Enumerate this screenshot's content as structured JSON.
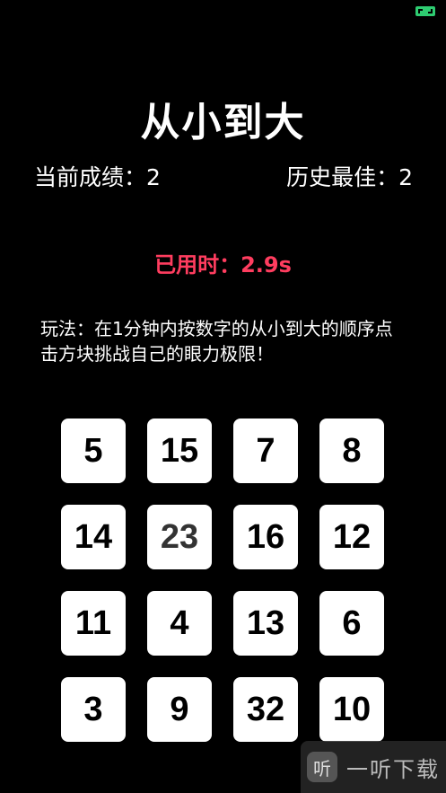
{
  "title": "从小到大",
  "score": {
    "current_label": "当前成绩：2",
    "best_label": "历史最佳：2"
  },
  "timer": "已用时：2.9s",
  "rules": "玩法：在1分钟内按数字的从小到大的顺序点击方块挑战自己的眼力极限！",
  "tiles": [
    "5",
    "15",
    "7",
    "8",
    "14",
    "23",
    "16",
    "12",
    "11",
    "4",
    "13",
    "6",
    "3",
    "9",
    "32",
    "10"
  ],
  "watermark": {
    "logo": "听",
    "text": "一听下载"
  },
  "colors": {
    "background": "#000000",
    "timer": "#ff3d5f",
    "tile": "#ffffff"
  }
}
